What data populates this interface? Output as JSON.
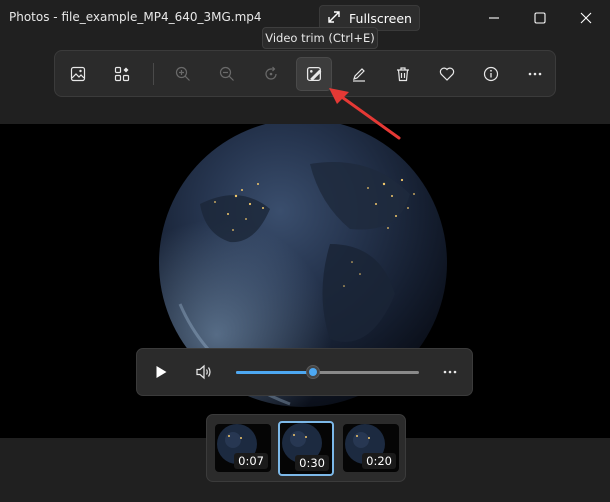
{
  "window": {
    "title": "Photos - file_example_MP4_640_3MG.mp4",
    "fullscreen_label": "Fullscreen"
  },
  "toolbar": {
    "buttons": [
      {
        "name": "view-image-icon",
        "enabled": true
      },
      {
        "name": "gallery-icon",
        "enabled": true
      },
      {
        "name": "zoom-in-icon",
        "enabled": false
      },
      {
        "name": "zoom-out-icon",
        "enabled": false
      },
      {
        "name": "rotate-icon",
        "enabled": false
      },
      {
        "name": "video-trim-icon",
        "enabled": true,
        "active": true
      },
      {
        "name": "draw-icon",
        "enabled": true
      },
      {
        "name": "delete-icon",
        "enabled": true
      },
      {
        "name": "favorite-icon",
        "enabled": true
      },
      {
        "name": "info-icon",
        "enabled": true
      },
      {
        "name": "more-icon",
        "enabled": true
      }
    ],
    "tooltip": "Video trim (Ctrl+E)"
  },
  "playback": {
    "progress": 0.42,
    "accent_color": "#4da8f2"
  },
  "filmstrip": {
    "items": [
      {
        "duration": "0:07",
        "selected": false
      },
      {
        "duration": "0:30",
        "selected": true
      },
      {
        "duration": "0:20",
        "selected": false
      }
    ]
  },
  "annotation": {
    "arrow_color": "#e53935"
  }
}
